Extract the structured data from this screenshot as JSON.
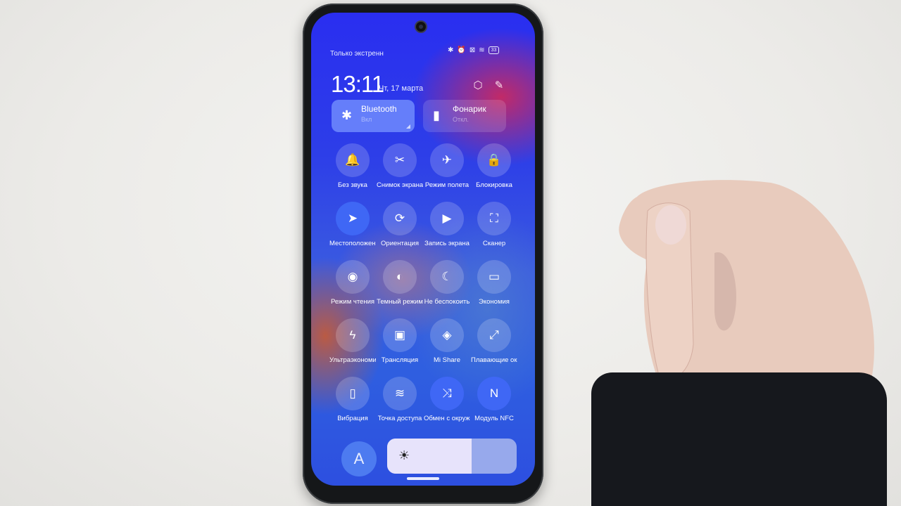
{
  "status_bar": {
    "notification_mode": "Только экстренн",
    "icons": [
      "bluetooth-icon",
      "alarm-icon",
      "no-sim-icon",
      "wifi-icon",
      "battery-icon"
    ],
    "battery_level": "33"
  },
  "header": {
    "time": "13:11",
    "date": "Чт, 17 марта",
    "settings_icon": "⬡",
    "edit_icon": "✎"
  },
  "big_tiles": [
    {
      "name": "Bluetooth",
      "status": "Вкл",
      "icon": "✱",
      "active": true
    },
    {
      "name": "Фонарик",
      "status": "Откл.",
      "icon": "▮",
      "active": false
    }
  ],
  "toggles": [
    [
      {
        "label": "Без звука",
        "icon": "🔔",
        "active": false
      },
      {
        "label": "Снимок экрана",
        "icon": "✂",
        "active": false
      },
      {
        "label": "Режим полета",
        "icon": "✈",
        "active": false
      },
      {
        "label": "Блокировка",
        "icon": "🔒",
        "active": false
      }
    ],
    [
      {
        "label": "Местоположение",
        "icon": "➤",
        "active": true
      },
      {
        "label": "Ориентация",
        "icon": "⟳",
        "active": false
      },
      {
        "label": "Запись экрана",
        "icon": "▶",
        "active": false
      },
      {
        "label": "Сканер",
        "icon": "⛶",
        "active": false
      }
    ],
    [
      {
        "label": "Режим чтения",
        "icon": "◉",
        "active": false
      },
      {
        "label": "Темный режим",
        "icon": "◐",
        "active": false
      },
      {
        "label": "Не беспокоить",
        "icon": "☾",
        "active": false
      },
      {
        "label": "Экономия",
        "icon": "▭",
        "active": false
      }
    ],
    [
      {
        "label": "Ультраэкономия",
        "icon": "ϟ",
        "active": false
      },
      {
        "label": "Трансляция",
        "icon": "▣",
        "active": false
      },
      {
        "label": "Mi Share",
        "icon": "◈",
        "active": false
      },
      {
        "label": "Плавающие окна",
        "icon": "⤢",
        "active": false
      }
    ],
    [
      {
        "label": "Вибрация",
        "icon": "▯",
        "active": false
      },
      {
        "label": "Точка доступа",
        "icon": "≋",
        "active": false
      },
      {
        "label": "Обмен с окружением",
        "icon": "⤨",
        "active": true
      },
      {
        "label": "Модуль NFC",
        "icon": "N",
        "active": true
      }
    ]
  ],
  "bottom": {
    "auto_brightness_label": "A",
    "brightness_percent": 65,
    "brightness_icon": "☀"
  }
}
